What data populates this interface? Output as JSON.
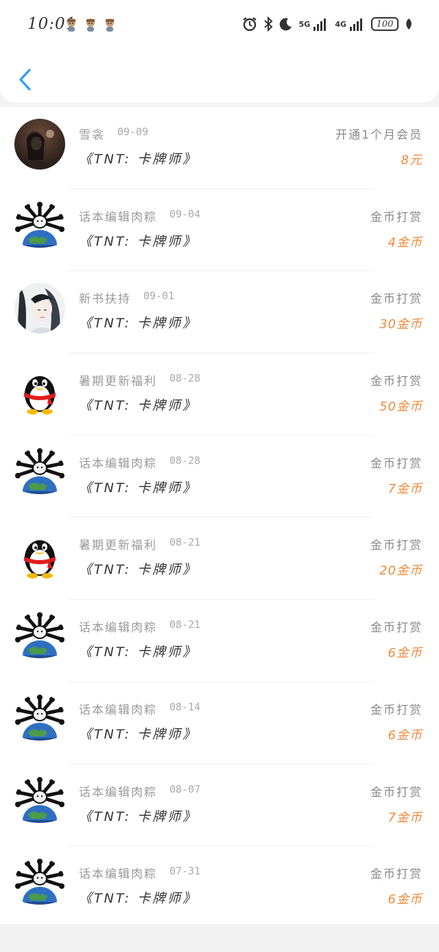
{
  "status_bar": {
    "time": "10:01",
    "battery": "100",
    "network_5g": "5G",
    "network_4g": "4G",
    "notification_icons": [
      "avatar-notif-icon",
      "avatar-notif-icon",
      "avatar-notif-icon"
    ],
    "system_icons": [
      "alarm-icon",
      "bluetooth-icon",
      "moon-icon",
      "signal-icon",
      "signal-icon",
      "battery-icon",
      "leaf-icon"
    ]
  },
  "nav": {
    "back_icon": "chevron-left-icon",
    "accent_color": "#2b9df4"
  },
  "colors": {
    "amount": "#f08a3c",
    "title": "#999999"
  },
  "records": [
    {
      "avatar": "night-portrait",
      "title": "雪衾",
      "date": "09-09",
      "book": "《TNT: 卡牌师》",
      "type": "开通1个月会员",
      "amount": "8元"
    },
    {
      "avatar": "spider-globe",
      "title": "话本编辑肉粽",
      "date": "09-04",
      "book": "《TNT: 卡牌师》",
      "type": "金币打赏",
      "amount": "4金币"
    },
    {
      "avatar": "ink-portrait",
      "title": "新书扶持",
      "date": "09-01",
      "book": "《TNT: 卡牌师》",
      "type": "金币打赏",
      "amount": "30金币"
    },
    {
      "avatar": "qq-penguin",
      "title": "暑期更新福利",
      "date": "08-28",
      "book": "《TNT: 卡牌师》",
      "type": "金币打赏",
      "amount": "50金币"
    },
    {
      "avatar": "spider-globe",
      "title": "话本编辑肉粽",
      "date": "08-28",
      "book": "《TNT: 卡牌师》",
      "type": "金币打赏",
      "amount": "7金币"
    },
    {
      "avatar": "qq-penguin",
      "title": "暑期更新福利",
      "date": "08-21",
      "book": "《TNT: 卡牌师》",
      "type": "金币打赏",
      "amount": "20金币"
    },
    {
      "avatar": "spider-globe",
      "title": "话本编辑肉粽",
      "date": "08-21",
      "book": "《TNT: 卡牌师》",
      "type": "金币打赏",
      "amount": "6金币"
    },
    {
      "avatar": "spider-globe",
      "title": "话本编辑肉粽",
      "date": "08-14",
      "book": "《TNT: 卡牌师》",
      "type": "金币打赏",
      "amount": "6金币"
    },
    {
      "avatar": "spider-globe",
      "title": "话本编辑肉粽",
      "date": "08-07",
      "book": "《TNT: 卡牌师》",
      "type": "金币打赏",
      "amount": "7金币"
    },
    {
      "avatar": "spider-globe",
      "title": "话本编辑肉粽",
      "date": "07-31",
      "book": "《TNT: 卡牌师》",
      "type": "金币打赏",
      "amount": "6金币"
    }
  ]
}
